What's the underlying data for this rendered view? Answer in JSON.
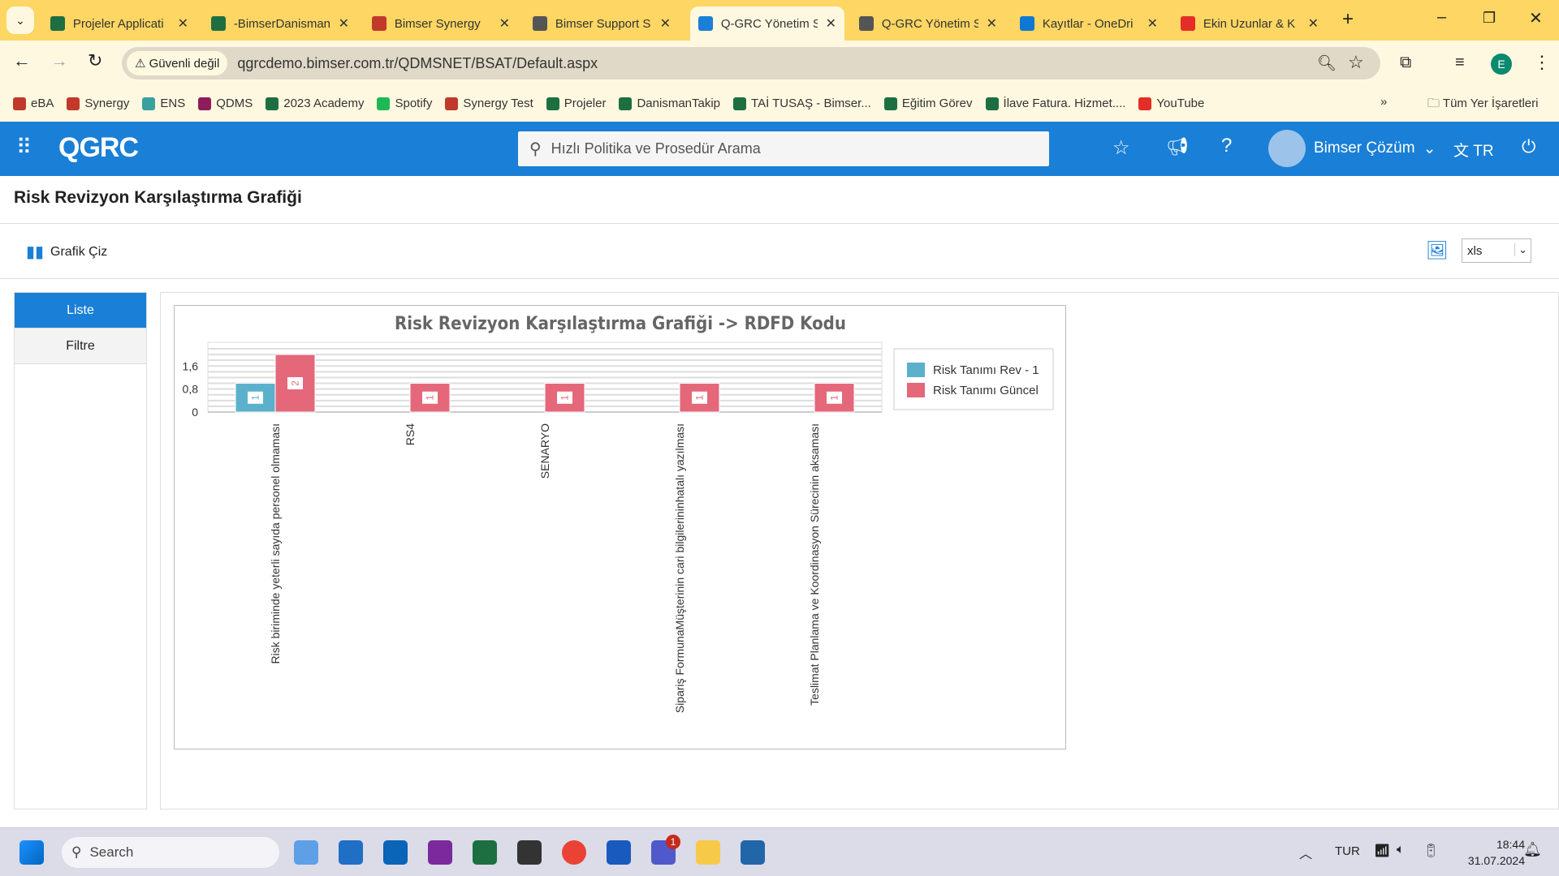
{
  "browser": {
    "tabs": [
      {
        "title": "Projeler Applicati",
        "icon": "excel-icon",
        "color": "#1d6f42"
      },
      {
        "title": "-BimserDanismanl",
        "icon": "excel-icon",
        "color": "#1d6f42"
      },
      {
        "title": "Bimser Synergy",
        "icon": "synergy-icon",
        "color": "#c0392b"
      },
      {
        "title": "Bimser Support S",
        "icon": "globe-icon",
        "color": "#555555"
      },
      {
        "title": "Q-GRC Yönetim S",
        "icon": "qgrc-icon",
        "color": "#1a7fd6",
        "active": true
      },
      {
        "title": "Q-GRC Yönetim S",
        "icon": "globe-icon",
        "color": "#555555"
      },
      {
        "title": "Kayıtlar - OneDri",
        "icon": "onedrive-icon",
        "color": "#0f78d4"
      },
      {
        "title": "Ekin Uzunlar & K",
        "icon": "youtube-icon",
        "color": "#e52d27"
      }
    ],
    "security_label": "Güvenli değil",
    "url": "qgrcdemo.bimser.com.tr/QDMSNET/BSAT/Default.aspx",
    "profile_initial": "E",
    "bookmarks": [
      {
        "label": "eBA",
        "color": "#c0392b"
      },
      {
        "label": "Synergy",
        "color": "#c0392b"
      },
      {
        "label": "ENS",
        "color": "#3aa0a0"
      },
      {
        "label": "QDMS",
        "color": "#8e1c5c"
      },
      {
        "label": "2023 Academy",
        "color": "#1d6f42"
      },
      {
        "label": "Spotify",
        "color": "#1db954"
      },
      {
        "label": "Synergy Test",
        "color": "#c0392b"
      },
      {
        "label": "Projeler",
        "color": "#1d6f42"
      },
      {
        "label": "DanismanTakip",
        "color": "#1d6f42"
      },
      {
        "label": "TAİ TUSAŞ - Bimser...",
        "color": "#1d6f42"
      },
      {
        "label": "Eğitim Görev",
        "color": "#1d6f42"
      },
      {
        "label": "İlave Fatura. Hizmet....",
        "color": "#1d6f42"
      },
      {
        "label": "YouTube",
        "color": "#e52d27"
      }
    ],
    "all_bookmarks": "Tüm Yer İşaretleri"
  },
  "app": {
    "logo": "QGRC",
    "search_placeholder": "Hızlı Politika ve Prosedür Arama",
    "user": "Bimser Çözüm",
    "language": "TR",
    "accent": "#1a7fd6"
  },
  "page": {
    "title": "Risk Revizyon Karşılaştırma Grafiği",
    "draw_button": "Grafik Çiz",
    "export_format": "xls",
    "sidebar": [
      {
        "label": "Liste",
        "active": true
      },
      {
        "label": "Filtre"
      }
    ]
  },
  "chart_data": {
    "type": "bar",
    "title": "Risk Revizyon Karşılaştırma Grafiği -> RDFD Kodu",
    "categories": [
      "Risk biriminde yeterli sayıda personel olmaması",
      "RS4",
      "SENARYO",
      "Sipariş FormunaMüşterinin cari bilgilerininhatalı yazılması",
      "Teslimat Planlama ve Koordinasyon Sürecinin aksaması"
    ],
    "series": [
      {
        "name": "Risk Tanımı Rev - 1",
        "color": "#5bb1cb",
        "values": [
          1,
          0,
          0,
          0,
          0
        ]
      },
      {
        "name": "Risk Tanımı Güncel",
        "color": "#e5677a",
        "values": [
          2,
          1,
          1,
          1,
          1
        ]
      }
    ],
    "yticks": [
      "0",
      "0,8",
      "1,6"
    ],
    "ytick_values": [
      0,
      0.8,
      1.6
    ],
    "ylim": [
      0,
      2.2
    ],
    "grid": true,
    "legend": "right"
  },
  "taskbar": {
    "search": "Search",
    "lang": "TUR",
    "time": "18:44",
    "date": "31.07.2024",
    "badge": "1"
  }
}
